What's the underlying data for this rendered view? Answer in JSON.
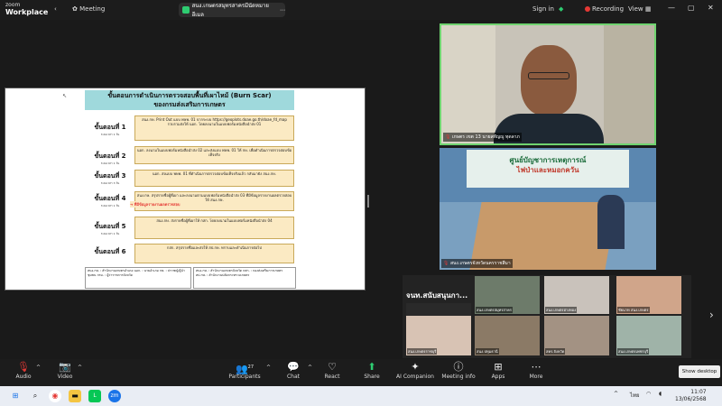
{
  "app": {
    "brand_line1": "zoom",
    "brand_line2": "Workplace",
    "tab": "Meeting"
  },
  "meeting_title": "สนง.เกษตรสมุทรสาครมีนัดหมายอีเมล",
  "topbar": {
    "signin": "Sign in",
    "recording": "Recording",
    "view": "View"
  },
  "slide": {
    "title_line1": "ขั้นตอนการดำเนินการตรวจสอบพื้นที่เผาไหม้ (Burn Scar)",
    "title_line2": "ของกรมส่งเสริมการเกษตร",
    "steps": [
      {
        "label": "ขั้นตอนที่ 1",
        "sub": "ระยะเวลา 1 วัน",
        "text": "สนง.กษ. Print Out แบบ พษพ. 01 จากระบบ https://geoplots.doae.go.th/doae_fd_map รวบรวมส่งให้ นอก. โดยลงนามในแบบฟอร์มหนังสือนำส่ง 01"
      },
      {
        "label": "ขั้นตอนที่ 2",
        "sub": "ระยะเวลา 1 วัน",
        "text": "นอก. ลงนามในแบบฟอร์มหนังสือนำส่ง 02 และส่งแบบ พษพ. 01 ให้ กษ. เพื่อดำเนินการตรวจสอบข้อเท็จจริง"
      },
      {
        "label": "ขั้นตอนที่ 3",
        "sub": "ระยะเวลา 3 วัน",
        "text": "นอก. ส่งแบบ พษพ. 01 ที่ดำเนินการตรวจสอบข้อเท็จจริงแล้ว กลับมายัง สนง.กษ."
      },
      {
        "label": "ขั้นตอนที่ 4",
        "sub": "ระยะเวลา 1 วัน",
        "text": "สนง.กษ. สรุปรายชื่อผู้ที่เผา และลงนามตามแบบฟอร์มหนังสือนำส่ง 03 ที่มีข้อมูลรายงานผลตรวจสอบให้ สนง.กษ."
      },
      {
        "label": "ขั้นตอนที่ 5",
        "sub": "ระยะเวลา 1 วัน",
        "text": "สนง.กษ. ส่งรายชื่อผู้ที่เผาให้ กสก. โดยลงนามในแบบฟอร์มหนังสือนำส่ง 04"
      },
      {
        "label": "ขั้นตอนที่ 6",
        "sub": "",
        "text": "กสก. สรุปรายชื่อและส่งให้ สป.กษ. ทราบและดำเนินการต่อไป"
      }
    ],
    "arrow_note": "ที่มีข้อมูลรายงานผลตรวจสอบ",
    "legend_left": "สนง.กษ. : สำนักงานเกษตรอำเภอ  นอก. : นายอำเภอ  กษ. : ปราชญ์/ผู้นำชุมชน  กรม. : ผู้ว่าราชการจังหวัด",
    "legend_right": "สนง.กษ. : สำนักงานเกษตรจังหวัด  กสก. : กองส่งเสริมการเกษตร  สป.กษ. : สำนักงานปลัดกระทรวงเกษตร"
  },
  "speaker": {
    "name": "เกษตร เขต 13 นายสหัญญู ทุดลาภ"
  },
  "room": {
    "name": "สนง.เกษตรจังหวัดนครราชสีมา",
    "banner1": "ศูนย์บัญชาการเหตุการณ์",
    "banner2": "ไฟป่าและหมอกควัน"
  },
  "gallery": {
    "header": "จนท.สนับสนุนกา...",
    "cells": [
      "จนท.สนับสนุนการ...",
      "สนง.เกษตรสมุทรสาคร",
      "สนง.เกษตรอ่างทอง",
      "ชัยนาท สนง.เกษตร",
      "สนง.เกษตรราชบุรี",
      "สนง.ปทุมธานี",
      "สคร.จังหวัด",
      "สนง.เกษตรเพชรบุรี"
    ]
  },
  "toolbar": {
    "items": [
      {
        "icon": "mic-off-icon",
        "glyph": "🎙",
        "label": "Audio"
      },
      {
        "icon": "video-off-icon",
        "glyph": "📷",
        "label": "Video"
      },
      {
        "icon": "participants-icon",
        "glyph": "👥",
        "label": "Participants",
        "count": "27"
      },
      {
        "icon": "chat-icon",
        "glyph": "💬",
        "label": "Chat"
      },
      {
        "icon": "react-icon",
        "glyph": "♡",
        "label": "React"
      },
      {
        "icon": "share-icon",
        "glyph": "⬆",
        "label": "Share"
      },
      {
        "icon": "ai-companion-icon",
        "glyph": "✦",
        "label": "AI Companion"
      },
      {
        "icon": "meeting-info-icon",
        "glyph": "ⓘ",
        "label": "Meeting info"
      },
      {
        "icon": "apps-icon",
        "glyph": "⊞",
        "label": "Apps"
      },
      {
        "icon": "more-icon",
        "glyph": "⋯",
        "label": "More"
      }
    ],
    "show_desktop": "Show desktop"
  },
  "taskbar": {
    "lang": "ไทย",
    "time": "11:07",
    "date": "13/06/2568"
  },
  "colors": {
    "accent_green": "#2ecc71",
    "record_red": "#e53935",
    "slide_title_bg": "#9fd9dc",
    "step_bg": "#fbeac3"
  }
}
